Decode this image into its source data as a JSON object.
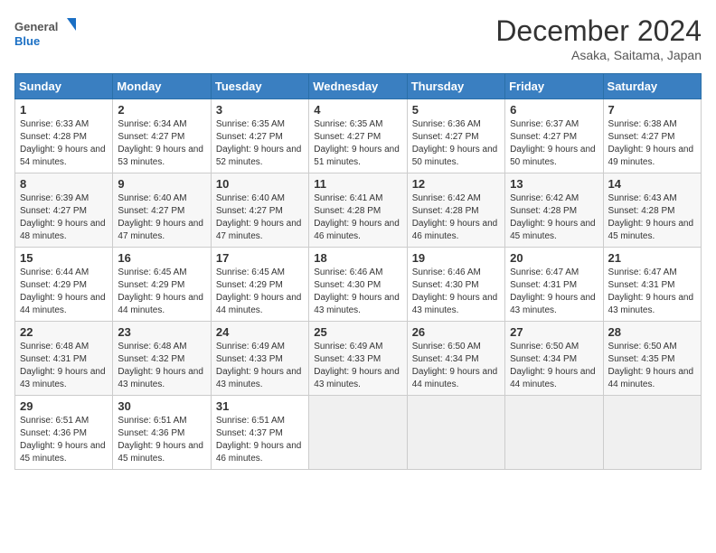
{
  "header": {
    "logo_general": "General",
    "logo_blue": "Blue",
    "month_title": "December 2024",
    "location": "Asaka, Saitama, Japan"
  },
  "weekdays": [
    "Sunday",
    "Monday",
    "Tuesday",
    "Wednesday",
    "Thursday",
    "Friday",
    "Saturday"
  ],
  "weeks": [
    [
      {
        "day": "1",
        "sunrise": "Sunrise: 6:33 AM",
        "sunset": "Sunset: 4:28 PM",
        "daylight": "Daylight: 9 hours and 54 minutes."
      },
      {
        "day": "2",
        "sunrise": "Sunrise: 6:34 AM",
        "sunset": "Sunset: 4:27 PM",
        "daylight": "Daylight: 9 hours and 53 minutes."
      },
      {
        "day": "3",
        "sunrise": "Sunrise: 6:35 AM",
        "sunset": "Sunset: 4:27 PM",
        "daylight": "Daylight: 9 hours and 52 minutes."
      },
      {
        "day": "4",
        "sunrise": "Sunrise: 6:35 AM",
        "sunset": "Sunset: 4:27 PM",
        "daylight": "Daylight: 9 hours and 51 minutes."
      },
      {
        "day": "5",
        "sunrise": "Sunrise: 6:36 AM",
        "sunset": "Sunset: 4:27 PM",
        "daylight": "Daylight: 9 hours and 50 minutes."
      },
      {
        "day": "6",
        "sunrise": "Sunrise: 6:37 AM",
        "sunset": "Sunset: 4:27 PM",
        "daylight": "Daylight: 9 hours and 50 minutes."
      },
      {
        "day": "7",
        "sunrise": "Sunrise: 6:38 AM",
        "sunset": "Sunset: 4:27 PM",
        "daylight": "Daylight: 9 hours and 49 minutes."
      }
    ],
    [
      {
        "day": "8",
        "sunrise": "Sunrise: 6:39 AM",
        "sunset": "Sunset: 4:27 PM",
        "daylight": "Daylight: 9 hours and 48 minutes."
      },
      {
        "day": "9",
        "sunrise": "Sunrise: 6:40 AM",
        "sunset": "Sunset: 4:27 PM",
        "daylight": "Daylight: 9 hours and 47 minutes."
      },
      {
        "day": "10",
        "sunrise": "Sunrise: 6:40 AM",
        "sunset": "Sunset: 4:27 PM",
        "daylight": "Daylight: 9 hours and 47 minutes."
      },
      {
        "day": "11",
        "sunrise": "Sunrise: 6:41 AM",
        "sunset": "Sunset: 4:28 PM",
        "daylight": "Daylight: 9 hours and 46 minutes."
      },
      {
        "day": "12",
        "sunrise": "Sunrise: 6:42 AM",
        "sunset": "Sunset: 4:28 PM",
        "daylight": "Daylight: 9 hours and 46 minutes."
      },
      {
        "day": "13",
        "sunrise": "Sunrise: 6:42 AM",
        "sunset": "Sunset: 4:28 PM",
        "daylight": "Daylight: 9 hours and 45 minutes."
      },
      {
        "day": "14",
        "sunrise": "Sunrise: 6:43 AM",
        "sunset": "Sunset: 4:28 PM",
        "daylight": "Daylight: 9 hours and 45 minutes."
      }
    ],
    [
      {
        "day": "15",
        "sunrise": "Sunrise: 6:44 AM",
        "sunset": "Sunset: 4:29 PM",
        "daylight": "Daylight: 9 hours and 44 minutes."
      },
      {
        "day": "16",
        "sunrise": "Sunrise: 6:45 AM",
        "sunset": "Sunset: 4:29 PM",
        "daylight": "Daylight: 9 hours and 44 minutes."
      },
      {
        "day": "17",
        "sunrise": "Sunrise: 6:45 AM",
        "sunset": "Sunset: 4:29 PM",
        "daylight": "Daylight: 9 hours and 44 minutes."
      },
      {
        "day": "18",
        "sunrise": "Sunrise: 6:46 AM",
        "sunset": "Sunset: 4:30 PM",
        "daylight": "Daylight: 9 hours and 43 minutes."
      },
      {
        "day": "19",
        "sunrise": "Sunrise: 6:46 AM",
        "sunset": "Sunset: 4:30 PM",
        "daylight": "Daylight: 9 hours and 43 minutes."
      },
      {
        "day": "20",
        "sunrise": "Sunrise: 6:47 AM",
        "sunset": "Sunset: 4:31 PM",
        "daylight": "Daylight: 9 hours and 43 minutes."
      },
      {
        "day": "21",
        "sunrise": "Sunrise: 6:47 AM",
        "sunset": "Sunset: 4:31 PM",
        "daylight": "Daylight: 9 hours and 43 minutes."
      }
    ],
    [
      {
        "day": "22",
        "sunrise": "Sunrise: 6:48 AM",
        "sunset": "Sunset: 4:31 PM",
        "daylight": "Daylight: 9 hours and 43 minutes."
      },
      {
        "day": "23",
        "sunrise": "Sunrise: 6:48 AM",
        "sunset": "Sunset: 4:32 PM",
        "daylight": "Daylight: 9 hours and 43 minutes."
      },
      {
        "day": "24",
        "sunrise": "Sunrise: 6:49 AM",
        "sunset": "Sunset: 4:33 PM",
        "daylight": "Daylight: 9 hours and 43 minutes."
      },
      {
        "day": "25",
        "sunrise": "Sunrise: 6:49 AM",
        "sunset": "Sunset: 4:33 PM",
        "daylight": "Daylight: 9 hours and 43 minutes."
      },
      {
        "day": "26",
        "sunrise": "Sunrise: 6:50 AM",
        "sunset": "Sunset: 4:34 PM",
        "daylight": "Daylight: 9 hours and 44 minutes."
      },
      {
        "day": "27",
        "sunrise": "Sunrise: 6:50 AM",
        "sunset": "Sunset: 4:34 PM",
        "daylight": "Daylight: 9 hours and 44 minutes."
      },
      {
        "day": "28",
        "sunrise": "Sunrise: 6:50 AM",
        "sunset": "Sunset: 4:35 PM",
        "daylight": "Daylight: 9 hours and 44 minutes."
      }
    ],
    [
      {
        "day": "29",
        "sunrise": "Sunrise: 6:51 AM",
        "sunset": "Sunset: 4:36 PM",
        "daylight": "Daylight: 9 hours and 45 minutes."
      },
      {
        "day": "30",
        "sunrise": "Sunrise: 6:51 AM",
        "sunset": "Sunset: 4:36 PM",
        "daylight": "Daylight: 9 hours and 45 minutes."
      },
      {
        "day": "31",
        "sunrise": "Sunrise: 6:51 AM",
        "sunset": "Sunset: 4:37 PM",
        "daylight": "Daylight: 9 hours and 46 minutes."
      },
      null,
      null,
      null,
      null
    ]
  ]
}
